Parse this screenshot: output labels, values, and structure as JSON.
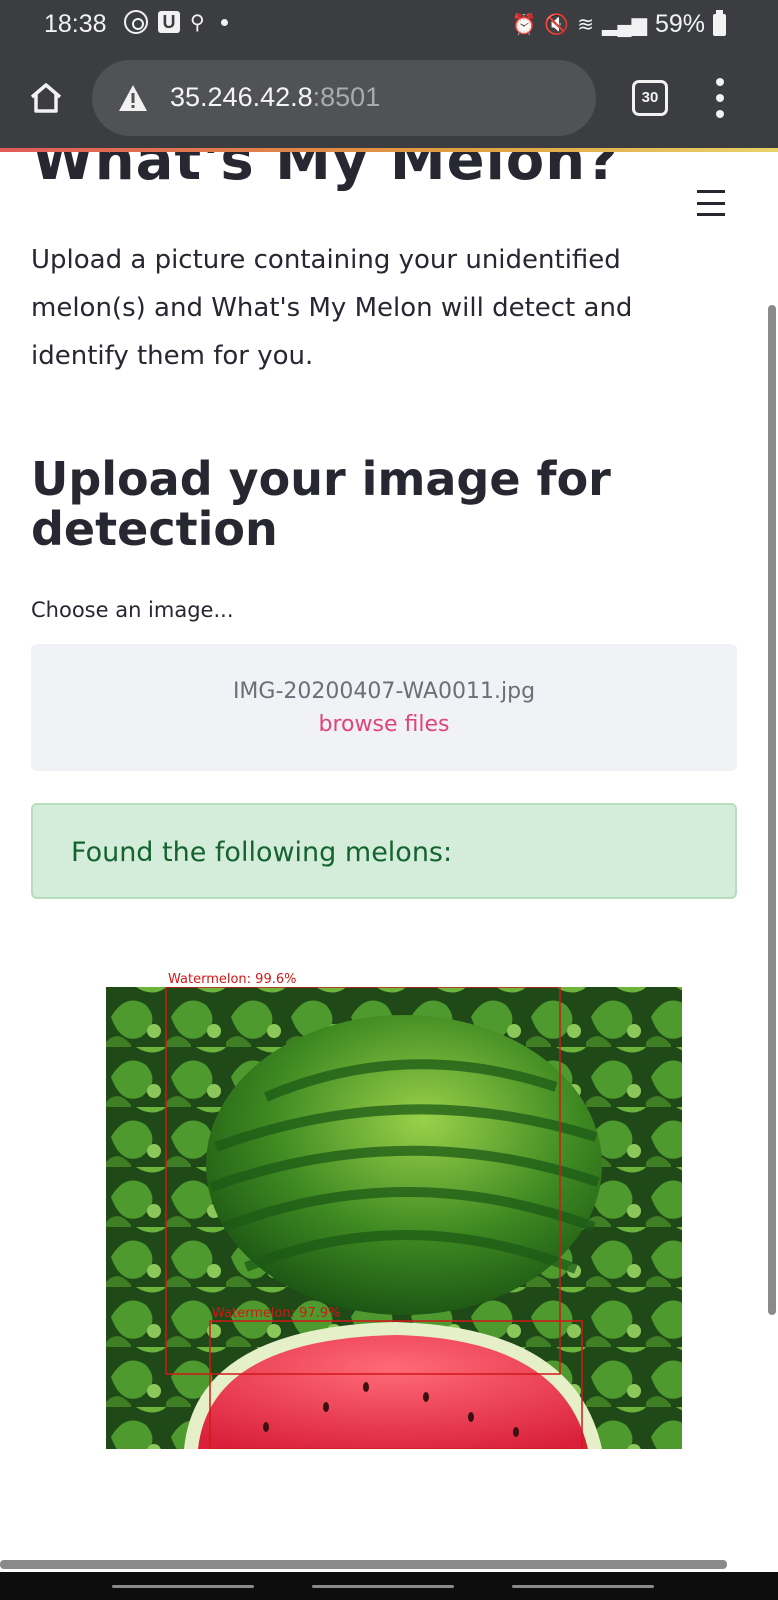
{
  "status_bar": {
    "time": "18:38",
    "battery": "59%",
    "icons": [
      "whatsapp-icon",
      "u-app-icon",
      "location-icon",
      "dot-icon",
      "alarm-icon",
      "mute-icon",
      "wifi-icon",
      "signal-icon",
      "battery-icon"
    ]
  },
  "browser": {
    "url_host": "35.246.42.8",
    "url_port": ":8501",
    "tab_count": "30",
    "icons": [
      "home-icon",
      "warning-icon",
      "tabs-icon",
      "more-vert-icon"
    ]
  },
  "page": {
    "title": "What's My Melon?",
    "intro": "Upload a picture containing your unidentified melon(s) and What's My Melon will detect and identify them for you.",
    "section_heading": "Upload your image for detection",
    "chooser_label": "Choose an image...",
    "file_name": "IMG-20200407-WA0011.jpg",
    "browse_label": "browse files",
    "result_message": "Found the following melons:"
  },
  "detections": [
    {
      "label": "Watermelon: 99.6%"
    },
    {
      "label": "Watermelon: 97.9%"
    }
  ],
  "colors": {
    "chrome_bg": "#3b3d40",
    "accent_link": "#e0447a",
    "success_bg": "#d4ecda",
    "success_text": "#14632f",
    "detection_box": "#d01818"
  }
}
